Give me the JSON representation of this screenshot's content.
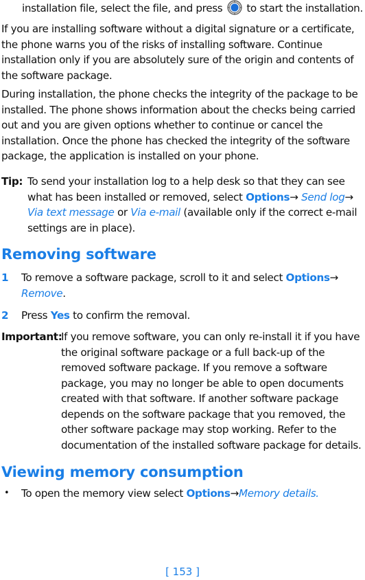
{
  "intro": {
    "line_before_icon": "installation file, select the file, and press",
    "icon": "select-key-icon",
    "line_after_icon": "to start the installation."
  },
  "paragraph_signature": "If you are installing software without a digital signature or a certificate, the phone warns you of the risks of installing software. Continue installation only if you are absolutely sure of the origin and contents of the software package.",
  "paragraph_integrity": "During installation, the phone checks the integrity of the package to be installed. The phone shows information about the checks being carried out and you are given options whether to continue or cancel the installation. Once the phone has checked the integrity of the software package, the application is installed on your phone.",
  "tip": {
    "label": "Tip:",
    "text_1": "To send your installation log to a help desk so that they can see what has been installed or removed, select",
    "options": "Options",
    "arrow": "→",
    "send_log": "Send log",
    "via_text": "Via text message",
    "or": "or",
    "via_email": "Via e-mail",
    "text_2": "(available only if the correct e-mail settings are in place)."
  },
  "section_removing": {
    "heading": "Removing software",
    "steps": [
      {
        "number": "1",
        "text": "To remove a software package, scroll to it and select",
        "options": "Options",
        "arrow": "→",
        "target": "Remove",
        "end": "."
      },
      {
        "number": "2",
        "text_before": "Press",
        "key": "Yes",
        "text_after": "to confirm the removal."
      }
    ],
    "important": {
      "label": "Important:",
      "text": "If you remove software, you can only re-install it if you have the original software package or a full back-up of the removed software package. If you remove a software package, you may no longer be able to open documents created with that software. If another software package depends on the software package that you removed, the other software package may stop working. Refer to the documentation of the installed software package for details."
    }
  },
  "section_memory": {
    "heading": "Viewing memory consumption",
    "bullets": [
      {
        "bullet": "•",
        "text": "To open the memory view select",
        "options": "Options",
        "arrow": "→",
        "target": "Memory details",
        "end": "."
      }
    ]
  },
  "page_number": "[ 153 ]",
  "colors": {
    "accent": "#1a7ee6",
    "text": "#111111"
  }
}
